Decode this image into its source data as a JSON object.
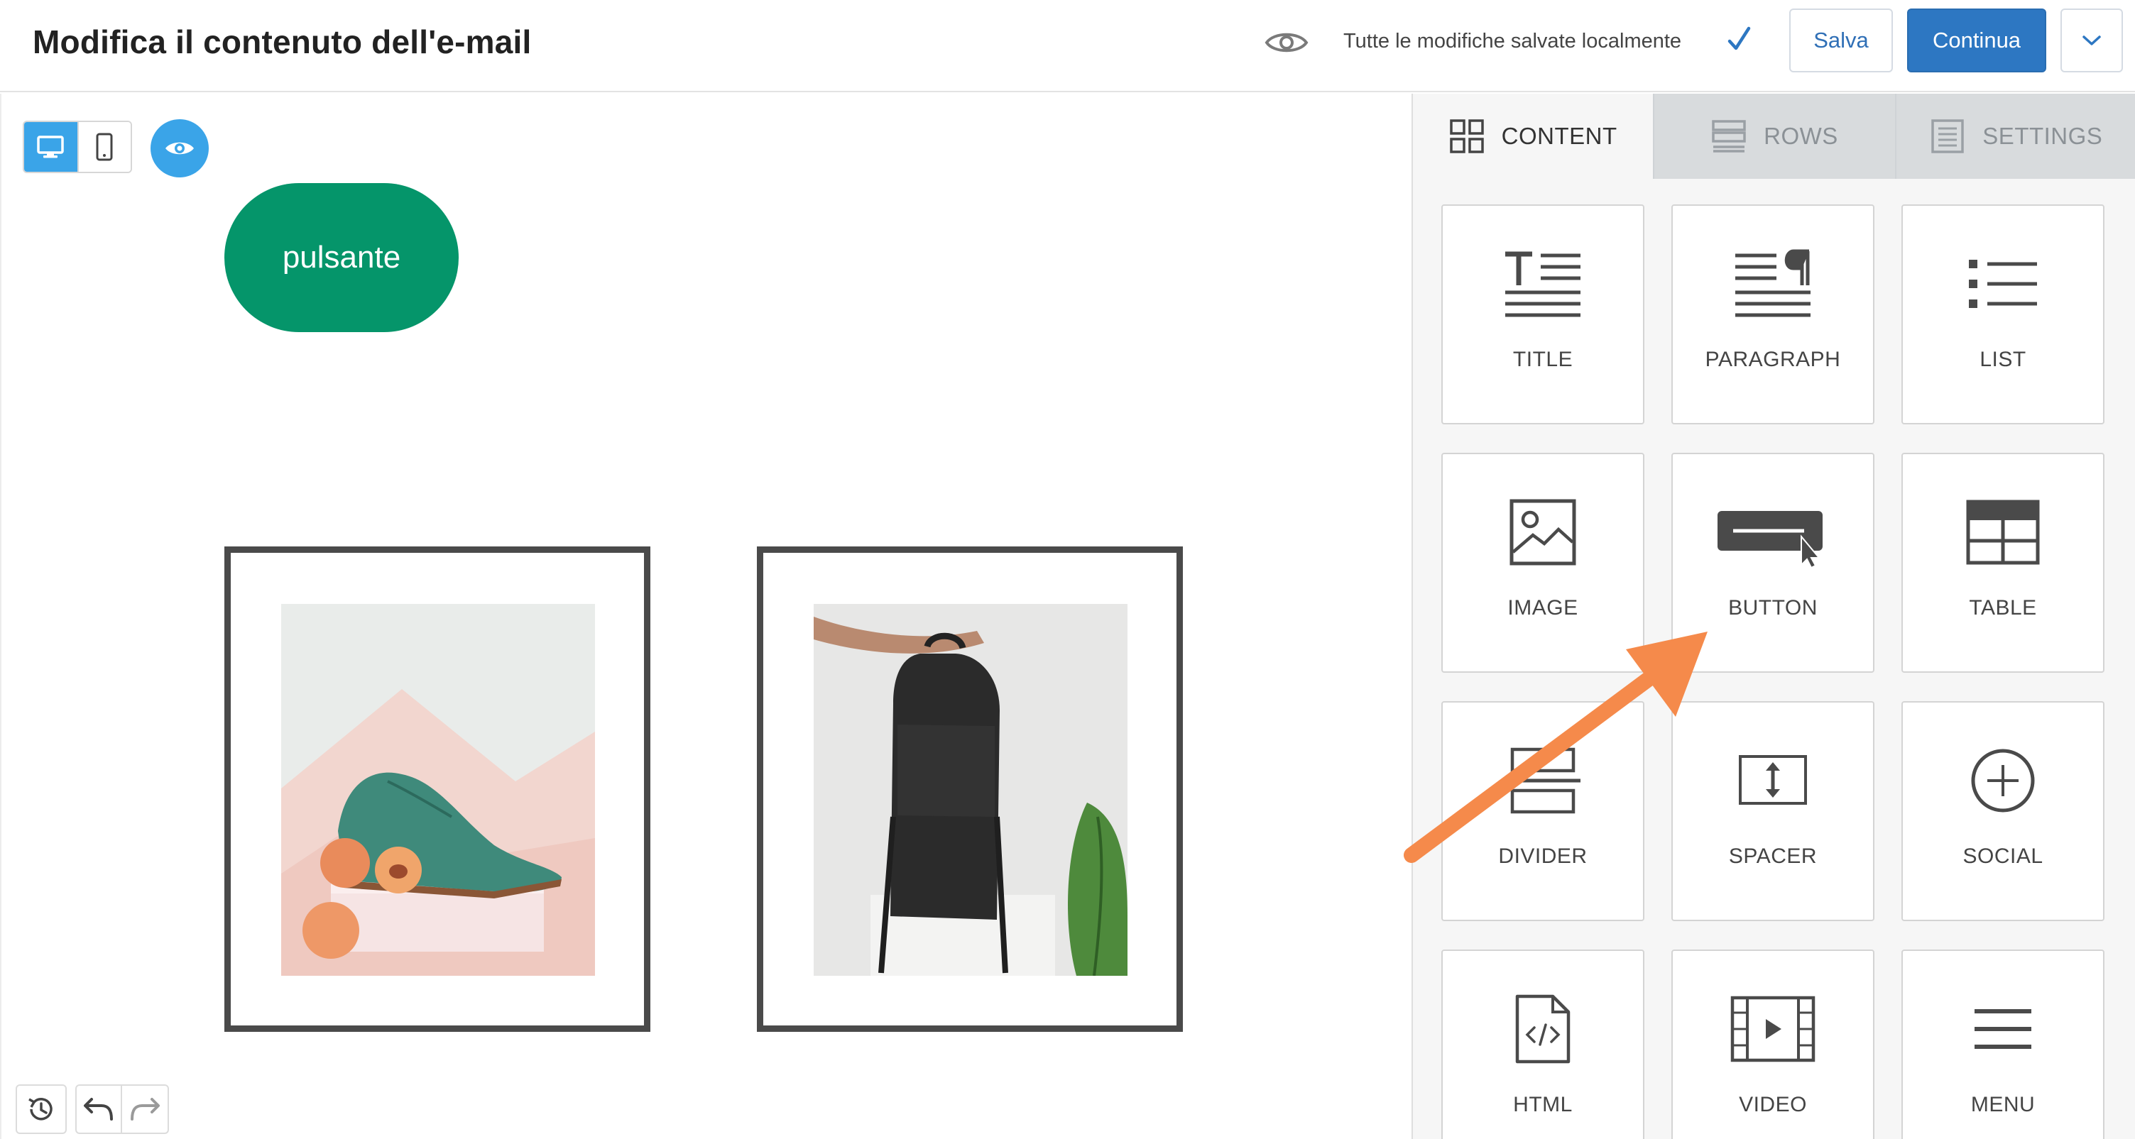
{
  "header": {
    "title": "Modifica il contenuto dell'e-mail",
    "status_text": "Tutte le modifiche salvate localmente",
    "save_label": "Salva",
    "continue_label": "Continua",
    "icons": [
      "eye-icon",
      "checkmark-icon",
      "chevron-down-icon"
    ]
  },
  "canvas": {
    "button_text": "pulsante",
    "button_color": "#05956a",
    "device_toggle": {
      "active": "desktop",
      "icons": [
        "desktop-icon",
        "mobile-icon"
      ]
    },
    "preview_icon": "eye-icon",
    "images": [
      {
        "description_icon": "product-photo-shoe"
      },
      {
        "description_icon": "product-photo-backpack"
      }
    ],
    "history_icons": [
      "history-icon",
      "undo-icon",
      "redo-icon"
    ]
  },
  "sidebar": {
    "tabs": [
      {
        "label": "CONTENT",
        "icon": "grid-icon",
        "active": true
      },
      {
        "label": "ROWS",
        "icon": "rows-icon",
        "active": false
      },
      {
        "label": "SETTINGS",
        "icon": "settings-icon",
        "active": false
      }
    ],
    "blocks": [
      {
        "label": "TITLE",
        "icon": "title-icon"
      },
      {
        "label": "PARAGRAPH",
        "icon": "paragraph-icon"
      },
      {
        "label": "LIST",
        "icon": "list-icon"
      },
      {
        "label": "IMAGE",
        "icon": "image-icon"
      },
      {
        "label": "BUTTON",
        "icon": "button-icon"
      },
      {
        "label": "TABLE",
        "icon": "table-icon"
      },
      {
        "label": "DIVIDER",
        "icon": "divider-icon"
      },
      {
        "label": "SPACER",
        "icon": "spacer-icon"
      },
      {
        "label": "SOCIAL",
        "icon": "social-icon"
      },
      {
        "label": "HTML",
        "icon": "html-icon"
      },
      {
        "label": "VIDEO",
        "icon": "video-icon"
      },
      {
        "label": "MENU",
        "icon": "menu-icon"
      }
    ]
  },
  "colors": {
    "accent_blue": "#2d77c2",
    "toggle_blue": "#3aa4e8",
    "annotation_orange": "#f58a4b",
    "icon_gray": "#4a4a4a"
  }
}
